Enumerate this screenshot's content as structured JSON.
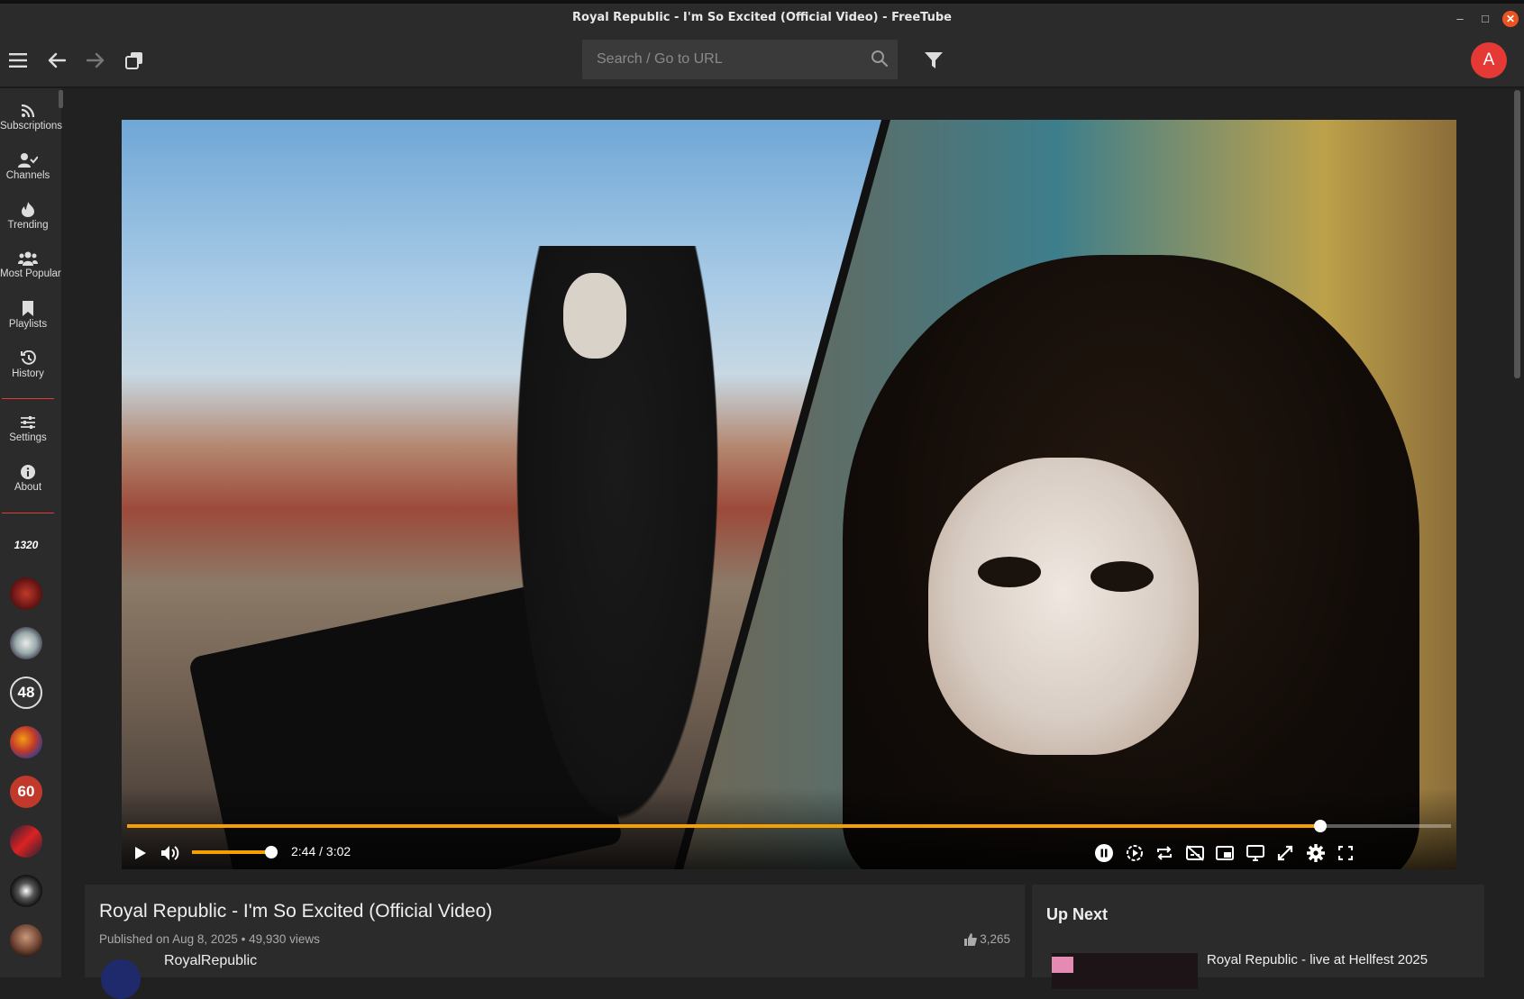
{
  "window": {
    "title": "Royal Republic - I'm So Excited (Official Video) - FreeTube",
    "minimize": "–",
    "maximize": "□",
    "close": "✕"
  },
  "topbar": {
    "search_placeholder": "Search / Go to URL",
    "avatar_letter": "A",
    "icons": [
      "menu-icon",
      "back-icon",
      "forward-icon",
      "new-window-icon",
      "search-icon",
      "filter-icon"
    ]
  },
  "sidebar": {
    "items": [
      {
        "label": "Subscriptions",
        "icon": "rss-icon"
      },
      {
        "label": "Channels",
        "icon": "user-check-icon"
      },
      {
        "label": "Trending",
        "icon": "fire-icon"
      },
      {
        "label": "Most Popular",
        "icon": "users-icon"
      },
      {
        "label": "Playlists",
        "icon": "bookmark-icon"
      },
      {
        "label": "History",
        "icon": "history-icon"
      },
      {
        "label": "Settings",
        "icon": "sliders-icon"
      },
      {
        "label": "About",
        "icon": "info-icon"
      }
    ],
    "channel_badges": [
      "1320",
      "",
      "",
      "48",
      "",
      "60",
      "",
      "",
      ""
    ]
  },
  "player": {
    "progress_fraction": 0.901,
    "volume_fraction": 0.94,
    "time": "2:44 / 3:02",
    "colors": {
      "accent": "#f5a000"
    }
  },
  "video": {
    "title": "Royal Republic - I'm So Excited (Official Video)",
    "meta": "Published on Aug 8, 2025 • 49,930 views",
    "likes": "3,265",
    "channel": "RoyalRepublic"
  },
  "upnext": {
    "header": "Up Next",
    "first_title": "Royal Republic - live at Hellfest 2025"
  },
  "colors": {
    "avatar": "#e53935",
    "divider": "#e53935",
    "panel": "#2b2b2b",
    "background": "#212121"
  }
}
